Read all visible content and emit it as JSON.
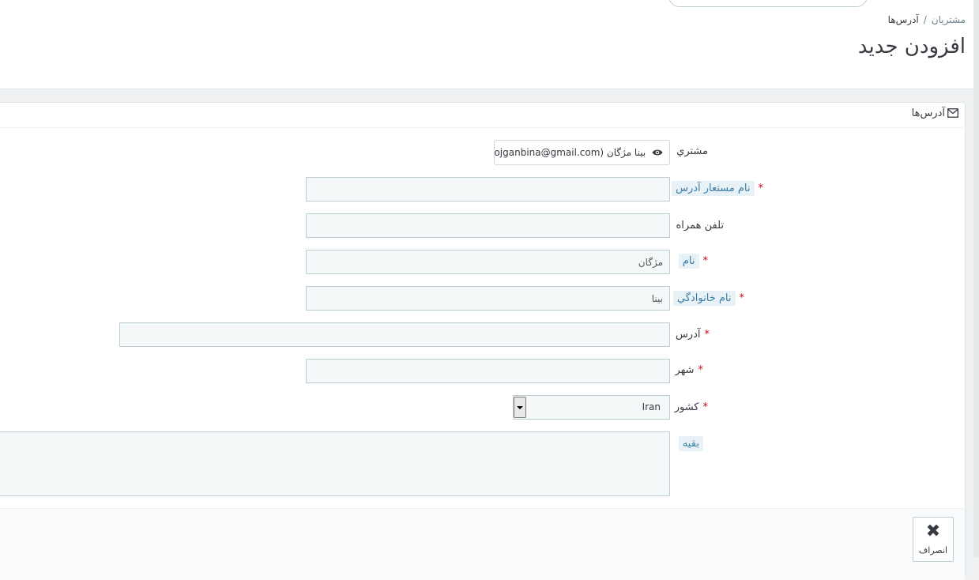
{
  "breadcrumb": {
    "parent": "مشتریان",
    "separator": "/",
    "current": "آدرس‌ها"
  },
  "page": {
    "title": "افزودن جدید"
  },
  "panel": {
    "heading": "آدرس‌ها",
    "heading_icon": "envelope-icon"
  },
  "form": {
    "customer": {
      "label": "مشتري",
      "value": "بینا مژگان (mojganbina@gmail.com)",
      "icon": "eye-icon"
    },
    "alias": {
      "label": "نام مستعار آدرس",
      "required": "*",
      "value": ""
    },
    "mobile": {
      "label": "تلفن همراه",
      "value": ""
    },
    "first_name": {
      "label": "نام",
      "required": "*",
      "value": "مژگان"
    },
    "last_name": {
      "label": "نام خانوادگي",
      "required": "*",
      "value": "بینا"
    },
    "address": {
      "label": "آدرس",
      "required": "*",
      "value": ""
    },
    "city": {
      "label": "شهر",
      "required": "*",
      "value": ""
    },
    "country": {
      "label": "کشور",
      "required": "*",
      "value": "Iran"
    },
    "other": {
      "label": "بقیه",
      "value": ""
    }
  },
  "footer": {
    "cancel_label": "انصراف",
    "cancel_icon": "close-icon"
  },
  "colors": {
    "required_star": "#d0021b",
    "hint_bg": "#e8f1f5",
    "hint_text": "#3a7ea7",
    "page_bg": "#eff1f2"
  }
}
